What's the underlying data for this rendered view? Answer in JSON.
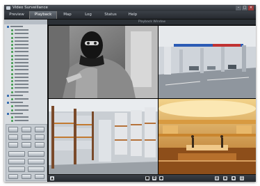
{
  "window": {
    "title": "Video Surveillance"
  },
  "menu": {
    "items": [
      {
        "label": "Preview"
      },
      {
        "label": "Playback"
      },
      {
        "label": "Map"
      },
      {
        "label": "Log"
      },
      {
        "label": "Status"
      },
      {
        "label": "Help"
      }
    ],
    "active_index": 1
  },
  "video": {
    "layout_label": "Playback Window",
    "tiles": [
      {
        "scene": "person-balaclava-icon"
      },
      {
        "scene": "parking-garage-icon"
      },
      {
        "scene": "warehouse-shelves-icon"
      },
      {
        "scene": "shopping-mall-icon"
      }
    ]
  },
  "toolbar_icons": [
    "play-icon",
    "stop-icon",
    "snapshot-icon",
    "record-icon",
    "grid-icon",
    "fullscreen-icon",
    "settings-icon",
    "layout-icon"
  ],
  "colors": {
    "accent": "#3a6fb0",
    "frame": "#1f2328"
  }
}
